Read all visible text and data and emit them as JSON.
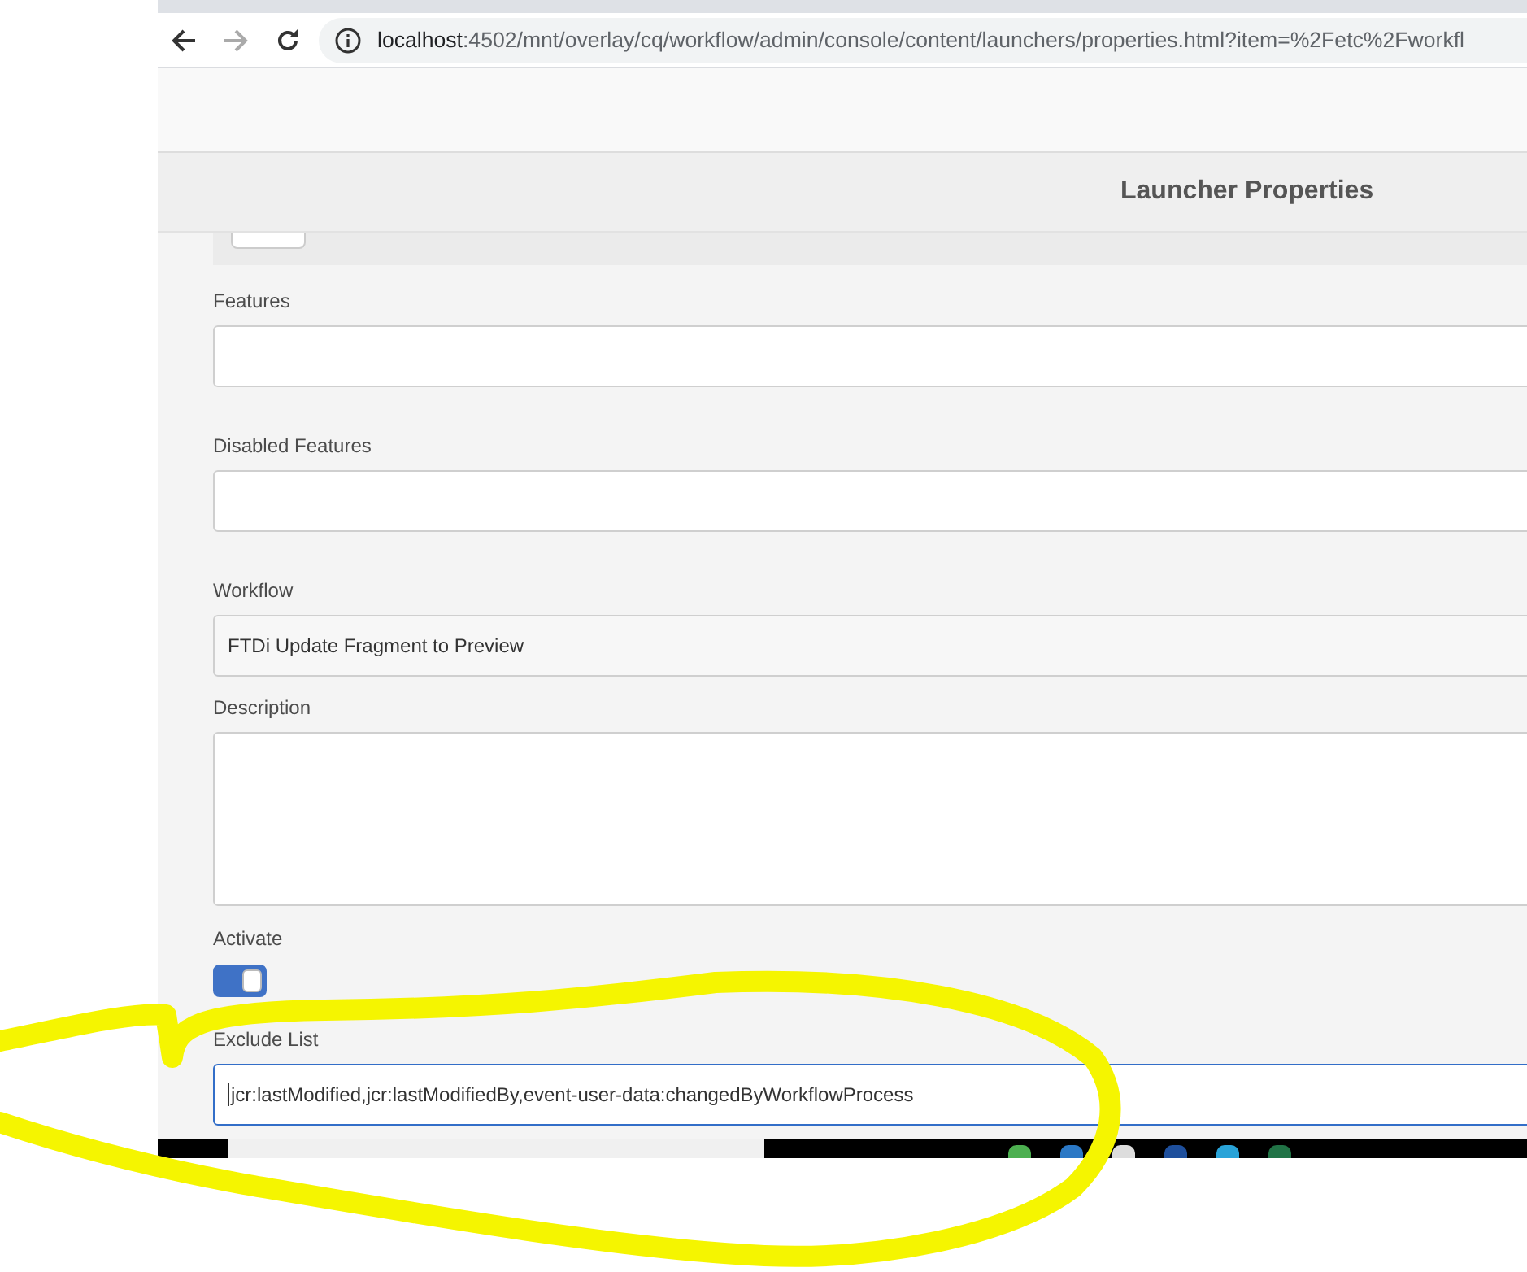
{
  "browser": {
    "address": {
      "host": "localhost",
      "path": ":4502/mnt/overlay/cq/workflow/admin/console/content/launchers/properties.html?item=%2Fetc%2Fworkfl"
    }
  },
  "header": {
    "title": "Launcher Properties"
  },
  "fields": [
    {
      "kind": "text",
      "label": "Features",
      "focused": false
    },
    {
      "kind": "text",
      "label": "Disabled Features",
      "focused": false
    },
    {
      "kind": "select",
      "label": "Workflow",
      "value": "FTDi Update Fragment to Preview"
    },
    {
      "kind": "textarea",
      "label": "Description"
    },
    {
      "kind": "switch",
      "label": "Activate",
      "on": true
    },
    {
      "kind": "text",
      "label": "Exclude List",
      "value": "jcr:lastModified,jcr:lastModifiedBy,event-user-data:changedByWorkflowProcess",
      "focused": true
    }
  ]
}
